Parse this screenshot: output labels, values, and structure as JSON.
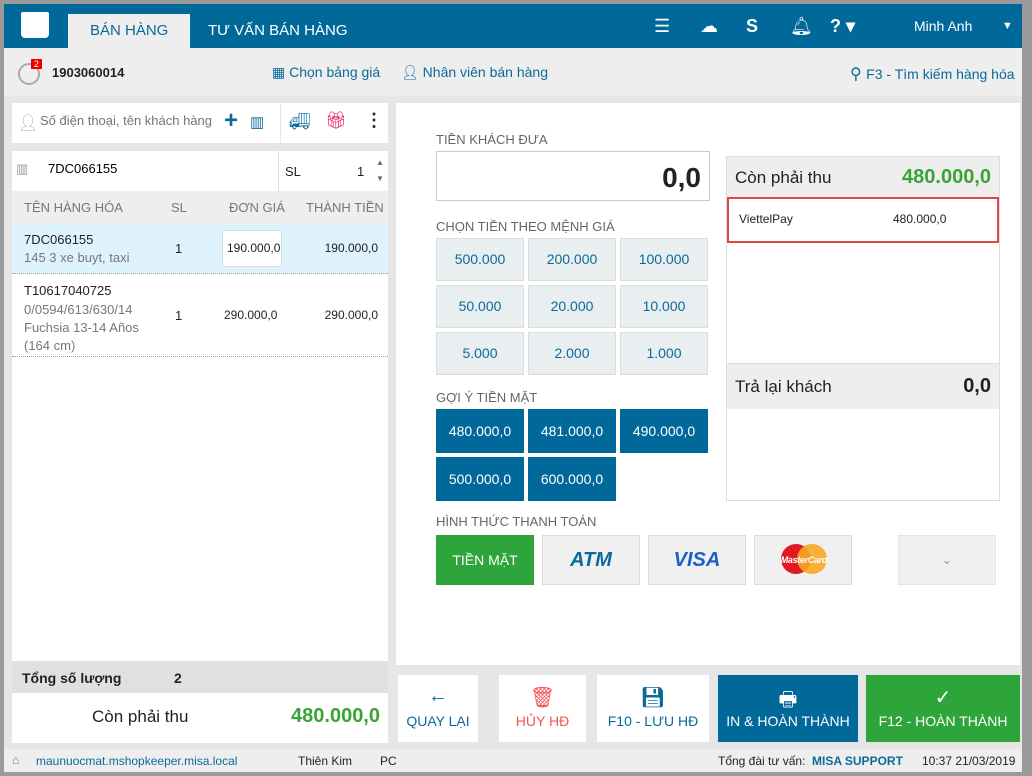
{
  "header": {
    "tabs": [
      "BÁN HÀNG",
      "TƯ VẤN BÁN HÀNG"
    ],
    "user": "Minh Anh"
  },
  "toolbar": {
    "badge": "2",
    "invoice_no": "1903060014",
    "price_list": "Chọn bảng giá",
    "staff": "Nhân viên bán hàng",
    "search": "F3 - Tìm kiếm hàng hóa"
  },
  "customer": {
    "placeholder": "Số điện thoại, tên khách hàng"
  },
  "scan": {
    "code": "7DC066155",
    "qty_label": "SL",
    "qty": "1"
  },
  "table": {
    "headers": [
      "TÊN HÀNG HÓA",
      "SL",
      "ĐƠN GIÁ",
      "THÀNH TIỀN"
    ],
    "rows": [
      {
        "code": "7DC066155",
        "desc": "145 3 xe buyt, taxi",
        "qty": "1",
        "price": "190.000,0",
        "total": "190.000,0"
      },
      {
        "code": "T10617040725",
        "desc": "0/0594/613/630/14 Fuchsia 13-14 Años (164 cm)",
        "qty": "1",
        "price": "290.000,0",
        "total": "290.000,0"
      }
    ]
  },
  "summary": {
    "total_qty_label": "Tổng số lượng",
    "total_qty": "2",
    "due_label": "Còn phải thu",
    "due": "480.000,0"
  },
  "payment": {
    "given_label": "TIỀN KHÁCH ĐƯA",
    "given": "0,0",
    "denom_label": "CHỌN TIỀN THEO MỆNH GIÁ",
    "denoms": [
      "500.000",
      "200.000",
      "100.000",
      "50.000",
      "20.000",
      "10.000",
      "5.000",
      "2.000",
      "1.000"
    ],
    "suggest_label": "GỢI Ý TIỀN MẶT",
    "suggest": [
      "480.000,0",
      "481.000,0",
      "490.000,0",
      "500.000,0",
      "600.000,0"
    ],
    "method_label": "HÌNH THỨC THANH TOÁN",
    "methods": [
      "TIỀN MẶT",
      "ATM",
      "VISA",
      "MasterCard"
    ],
    "due_label": "Còn phải thu",
    "due": "480.000,0",
    "lines": [
      {
        "name": "ViettelPay",
        "amount": "480.000,0"
      }
    ],
    "change_label": "Trả lại khách",
    "change": "0,0"
  },
  "actions": [
    "QUAY LẠI",
    "HỦY HĐ",
    "F10 - LƯU HĐ",
    "IN & HOÀN THÀNH",
    "F12 - HOÀN THÀNH"
  ],
  "status": {
    "domain": "maunuocmat.mshopkeeper.misa.local",
    "user": "Thiên Kim",
    "device": "PC",
    "support_label": "Tổng đài tư vấn:",
    "support": "MISA SUPPORT",
    "datetime": "10:37 21/03/2019"
  }
}
